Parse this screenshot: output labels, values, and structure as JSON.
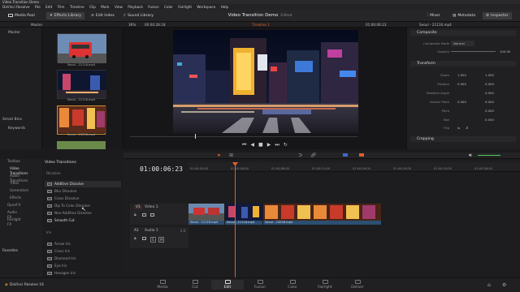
{
  "window_title": "Video Transition Demo",
  "menu": [
    "DaVinci Resolve",
    "File",
    "Edit",
    "Trim",
    "Timeline",
    "Clip",
    "Mark",
    "View",
    "Playback",
    "Fusion",
    "Color",
    "Fairlight",
    "Workspace",
    "Help"
  ],
  "toolbar": {
    "media_pool": "Media Pool",
    "effects_library": "Effects Library",
    "edit_index": "Edit Index",
    "sound_library": "Sound Library",
    "project_title": "Video Transition Demo",
    "project_status": "Edited",
    "mixer": "Mixer",
    "metadata": "Metadata",
    "inspector": "Inspector"
  },
  "subbar": {
    "master": "Master",
    "zoom": "36%",
    "source_tc": "00:00:28:18",
    "timeline_name": "Timeline 1",
    "record_tc": "01:00:06:23",
    "clip_name": "Seoul - 21116.mp4"
  },
  "media_tree": {
    "master": "Master",
    "smart_bins": "Smart Bins",
    "keywords": "Keywords"
  },
  "thumbnails": [
    {
      "label": "Seoul - 21116.mp4"
    },
    {
      "label": "Seoul - 21116.mp4"
    },
    {
      "label": "Seoul - 23258.mp4"
    }
  ],
  "inspector": {
    "composite_title": "Composite",
    "composite_mode_label": "Composite Mode",
    "composite_mode_value": "Normal",
    "opacity_label": "Opacity",
    "opacity_value": "100.00",
    "transform_title": "Transform",
    "rows": [
      {
        "label": "Zoom",
        "x": "1.000",
        "y": "1.000"
      },
      {
        "label": "Position",
        "x": "0.000",
        "y": "0.000"
      },
      {
        "label": "Rotation Angle",
        "x": "",
        "y": "0.000"
      },
      {
        "label": "Anchor Point",
        "x": "0.000",
        "y": "0.000"
      },
      {
        "label": "Pitch",
        "x": "",
        "y": "0.000"
      },
      {
        "label": "Yaw",
        "x": "",
        "y": "0.000"
      },
      {
        "label": "Flip",
        "x": "",
        "y": ""
      }
    ],
    "cropping_title": "Cropping"
  },
  "effects": {
    "tree": [
      "Toolbox",
      "Video Transitions",
      "Audio Transitions",
      "Titles",
      "Generators",
      "Effects",
      "OpenFX",
      "Audio FX",
      "Fairlight FX"
    ],
    "favorites": "Favorites",
    "panel_title": "Video Transitions",
    "dissolve_header": "Dissolve",
    "dissolve_items": [
      "Additive Dissolve",
      "Blur Dissolve",
      "Cross Dissolve",
      "Dip To Color Dissolve",
      "Non-Additive Dissolve",
      "Smooth Cut"
    ],
    "iris_header": "Iris",
    "iris_items": [
      "Arrow Iris",
      "Cross Iris",
      "Diamond Iris",
      "Eye Iris",
      "Hexagon Iris"
    ]
  },
  "timeline": {
    "timecode": "01:00:06:23",
    "ruler": [
      "01:00:00:00",
      "01:00:04:00",
      "01:00:08:00",
      "01:00:12:00",
      "01:00:16:00",
      "01:00:20:00",
      "01:00:24:00",
      "01:00:28:00"
    ],
    "video_track_id": "V1",
    "video_track_name": "Video 1",
    "audio_track_id": "A1",
    "audio_track_name": "Audio 1",
    "audio_level": "2.0",
    "clips": [
      {
        "label": "Seoul - 21116.mp4"
      },
      {
        "label": "Seoul - 21116.mp4"
      },
      {
        "label": "Seoul - 23258.mp4"
      }
    ]
  },
  "pages": [
    "Media",
    "Cut",
    "Edit",
    "Fusion",
    "Color",
    "Fairlight",
    "Deliver"
  ],
  "app_name": "DaVinci Resolve 16",
  "colors": {
    "accent": "#d28a2e",
    "clip": "#2b4f72",
    "playhead": "#e06030"
  }
}
